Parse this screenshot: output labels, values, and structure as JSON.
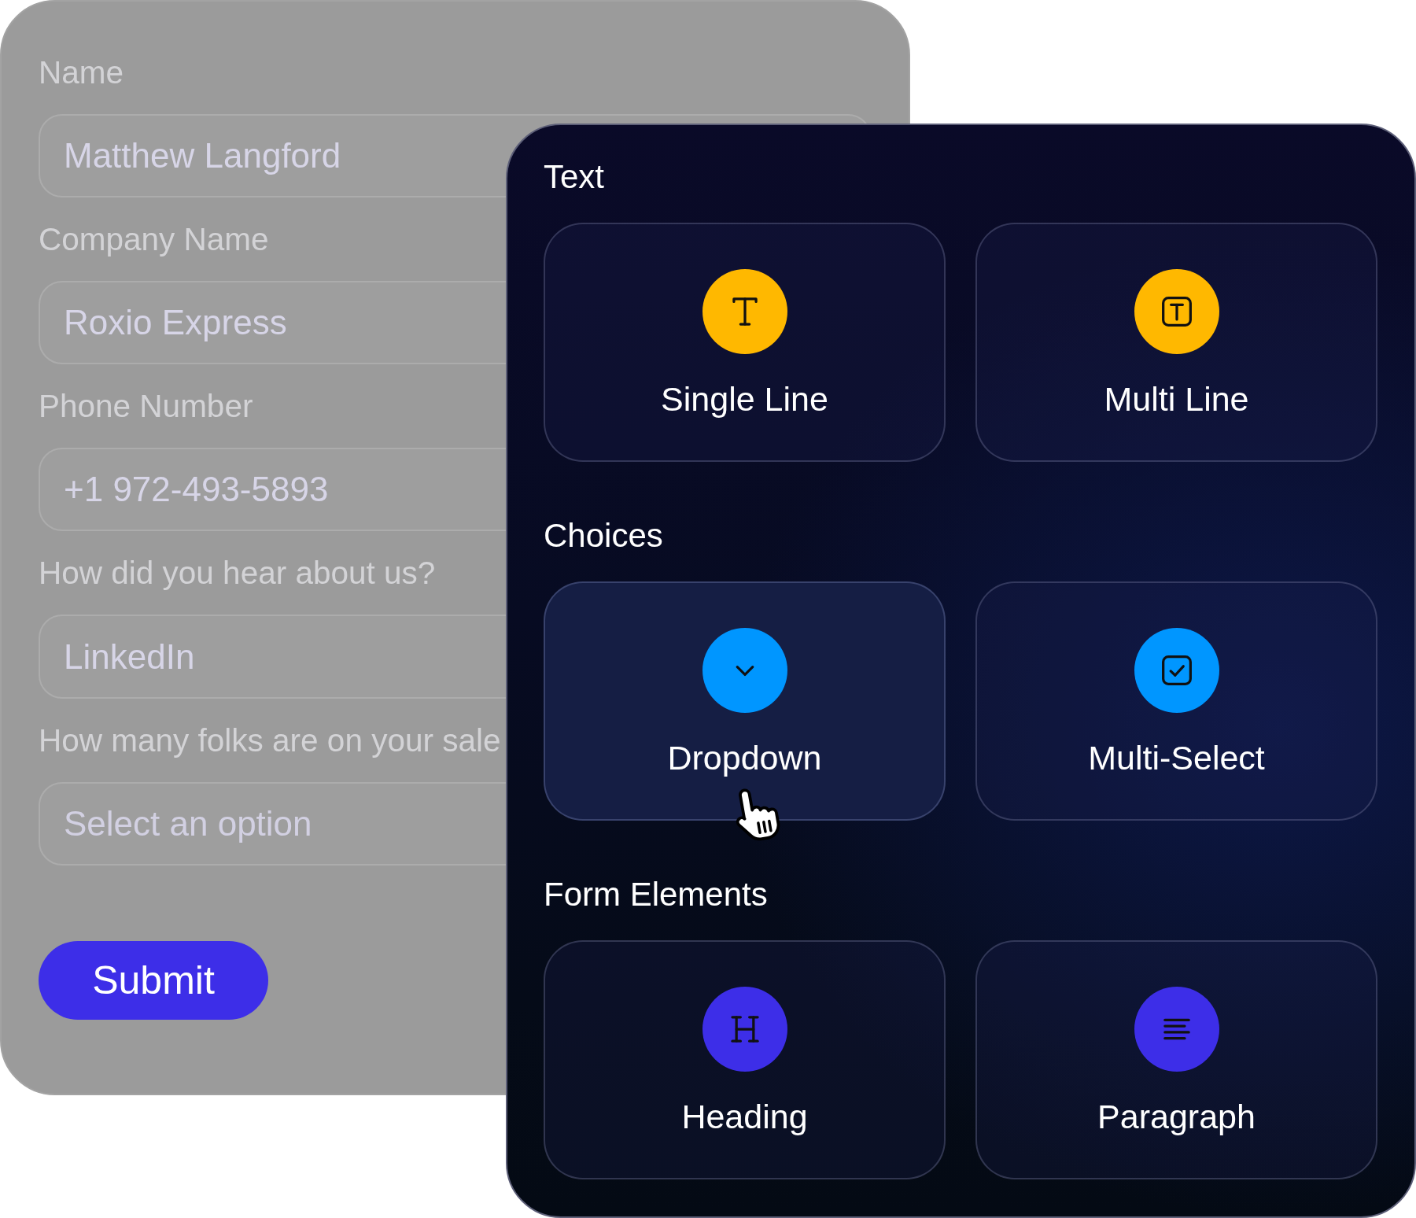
{
  "form": {
    "fields": [
      {
        "label": "Name",
        "value": "Matthew Langford"
      },
      {
        "label": "Company Name",
        "value": "Roxio Express"
      },
      {
        "label": "Phone Number",
        "value": "+1 972-493-5893"
      },
      {
        "label": "How did you hear about us?",
        "value": "LinkedIn"
      },
      {
        "label": "How many folks are on your sale",
        "placeholder": "Select an option"
      }
    ],
    "submit_button": "Submit"
  },
  "field_picker": {
    "sections": [
      {
        "title": "Text",
        "color": "#ffb800",
        "items": [
          {
            "label": "Single Line",
            "kind": "text",
            "selected": false
          },
          {
            "label": "Multi Line",
            "kind": "textarea",
            "selected": false
          }
        ]
      },
      {
        "title": "Choices",
        "color": "#0096ff",
        "items": [
          {
            "label": "Dropdown",
            "kind": "dropdown",
            "selected": true
          },
          {
            "label": "Multi-Select",
            "kind": "checkbox",
            "selected": false
          }
        ]
      },
      {
        "title": "Form Elements",
        "color": "#3d2ee8",
        "items": [
          {
            "label": "Heading",
            "kind": "heading",
            "selected": false
          },
          {
            "label": "Paragraph",
            "kind": "paragraph",
            "selected": false
          }
        ]
      }
    ]
  }
}
